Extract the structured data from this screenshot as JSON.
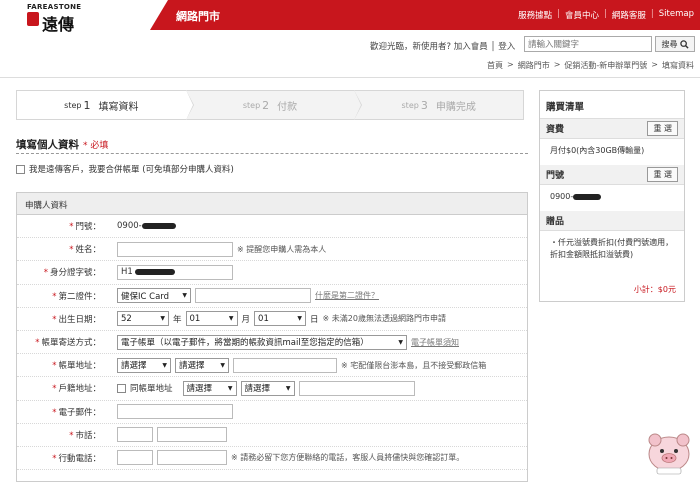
{
  "header": {
    "logo_en": "FAREASTONE",
    "logo_zh": "遠傳",
    "site_title": "網路門市",
    "links": [
      "服務據點",
      "會員中心",
      "網路客服",
      "Sitemap"
    ]
  },
  "subbar": {
    "welcome": "歡迎光臨，新使用者? 加入會員 │ 登入",
    "search_placeholder": "請輸入關鍵字",
    "search_button": "搜尋",
    "breadcrumb": [
      "首頁",
      "網路門市",
      "促銷活動-新申辦單門號",
      "填寫資料"
    ]
  },
  "steps": [
    {
      "prefix": "step",
      "num": "1",
      "label": "填寫資料",
      "active": true
    },
    {
      "prefix": "step",
      "num": "2",
      "label": "付款",
      "active": false
    },
    {
      "prefix": "step",
      "num": "3",
      "label": "申購完成",
      "active": false
    }
  ],
  "section": {
    "title": "填寫個人資料",
    "required_mark": "* 必填",
    "existing_customer": "我是遠傳客戶，我要合併帳單 (可免填部分申購人資料)"
  },
  "form": {
    "head": "申購人資料",
    "phone_label": "門號：",
    "phone_prefix": "0900-",
    "name_label": "姓名：",
    "name_note": "※ 提醒您申購人需為本人",
    "id_label": "身分證字號：",
    "id_prefix": "H1",
    "second_id_label": "第二證件：",
    "second_id_value": "健保IC Card",
    "second_id_link": "什麼是第二證件？",
    "birth_label": "出生日期：",
    "birth_year": "52",
    "birth_year_unit": "年",
    "birth_month": "01",
    "birth_month_unit": "月",
    "birth_day": "01",
    "birth_day_unit": "日",
    "birth_note": "※ 未滿20歲無法透過網路門市申請",
    "bill_label": "帳單寄送方式：",
    "bill_value": "電子帳單（以電子郵件，將當期的帳款資訊mail至您指定的信箱）",
    "bill_link": "電子帳單須知",
    "bill_addr_label": "帳單地址：",
    "select_placeholder": "請選擇",
    "bill_addr_note": "※ 宅配僅限台澎本島，且不接受郵政信箱",
    "household_label": "戶籍地址：",
    "same_as_bill": "同帳單地址",
    "email_label": "電子郵件：",
    "tel_label": "市話：",
    "mobile_label": "行動電話：",
    "mobile_note": "※ 請務必留下您方便聯絡的電話，客服人員將儘快與您確認訂單。"
  },
  "cart": {
    "title": "購買清單",
    "fee_title": "資費",
    "fee_value": "月付$0(內含30GB傳輸量)",
    "number_title": "門號",
    "number_prefix": "0900-",
    "reselect": "重 選",
    "gift_title": "贈品",
    "gift_value": "・仟元溢號費折扣(付費門號適用，折扣金額限抵扣溢號費)",
    "subtotal": "小計：$0元"
  },
  "icons": {
    "search": "magnifier-icon",
    "warning": "reference-mark"
  },
  "colors": {
    "brand_red": "#c8161d"
  }
}
